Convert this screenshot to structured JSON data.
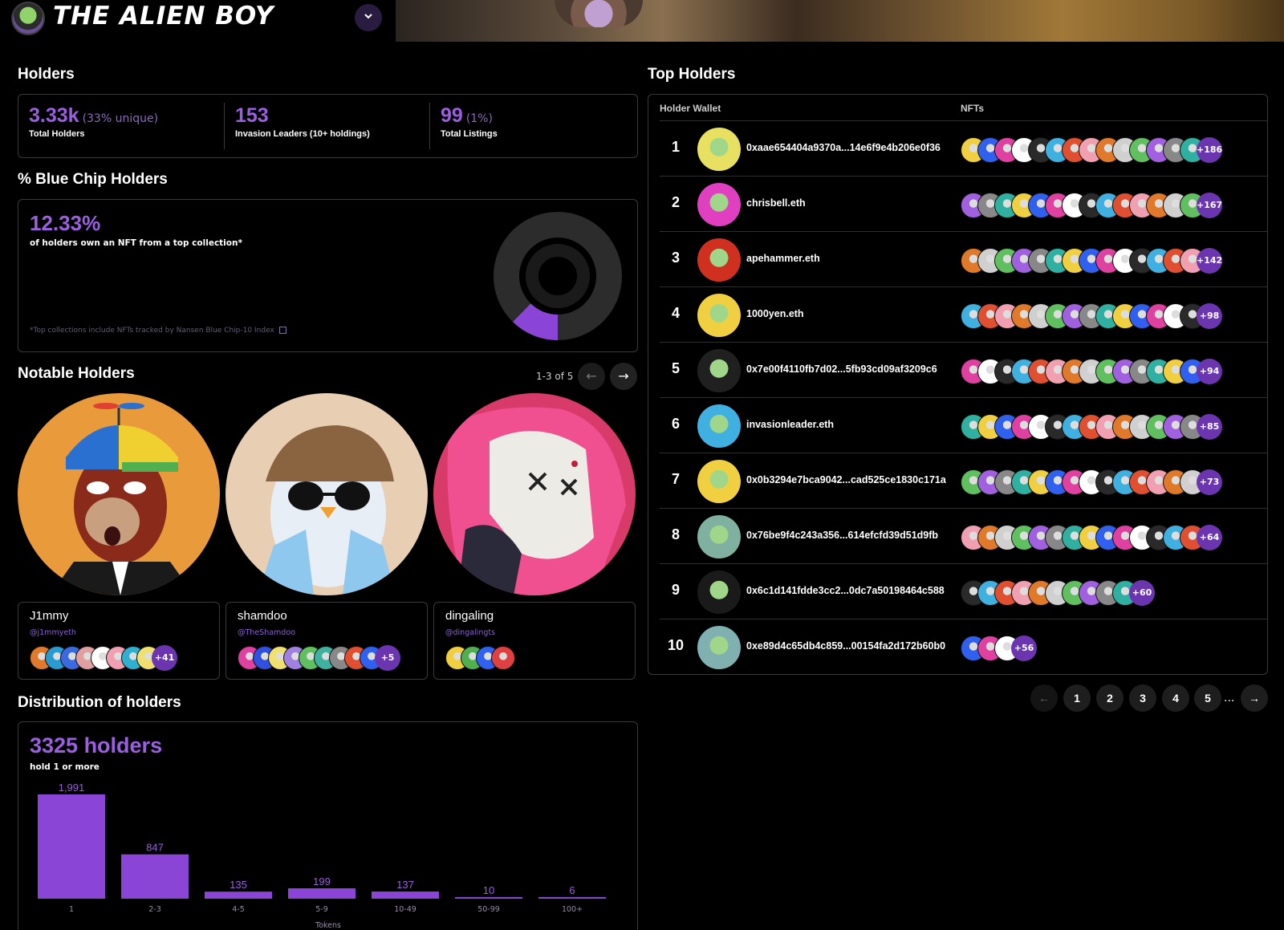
{
  "app": {
    "title": "THE ALIEN BOY",
    "dropdown_icon": "chevron-down-icon"
  },
  "holders": {
    "title": "Holders",
    "total": {
      "value": "3.33k",
      "note": "(33% unique)",
      "label": "Total Holders"
    },
    "leaders": {
      "value": "153",
      "label": "Invasion Leaders (10+ holdings)"
    },
    "listings": {
      "value": "99",
      "note": "(1%)",
      "label": "Total Listings"
    }
  },
  "blue_chip": {
    "title": "% Blue Chip Holders",
    "percent": "12.33%",
    "subtitle": "of holders own an NFT from a top collection*",
    "note": "*Top collections include NFTs tracked by Nansen Blue Chip-10 Index",
    "share": 0.1233,
    "colors": {
      "accent": "#8b45d6",
      "track": "#2c2c2c"
    }
  },
  "notable": {
    "title": "Notable Holders",
    "range": "1-3 of 5",
    "holders": [
      {
        "name": "J1mmy",
        "handle": "@j1mmyeth",
        "more": "+41",
        "avatar_colors": [
          "#e07a2a",
          "#2a9ad0",
          "#3a6ae0",
          "#e0a0a0",
          "#ffffff",
          "#f0a0b0",
          "#30b0d0",
          "#f0e070"
        ]
      },
      {
        "name": "shamdoo",
        "handle": "@TheShamdoo",
        "more": "+5",
        "avatar_colors": [
          "#e040a0",
          "#3050e0",
          "#f0e070",
          "#a080e0",
          "#60c060",
          "#40b0a0",
          "#888888",
          "#e05030",
          "#3060f0"
        ]
      },
      {
        "name": "dingaling",
        "handle": "@dingalingts",
        "more": "",
        "avatar_colors": [
          "#f0d040",
          "#50b050",
          "#3060f0",
          "#e04040"
        ]
      }
    ]
  },
  "distribution": {
    "title": "Distribution of holders",
    "total": "3325 holders",
    "subtitle": "hold 1 or more"
  },
  "chart_data": {
    "type": "bar",
    "categories": [
      "1",
      "2-3",
      "4-5",
      "5-9",
      "10-49",
      "50-99",
      "100+"
    ],
    "values": [
      1991,
      847,
      135,
      199,
      137,
      10,
      6
    ],
    "xlabel": "Tokens",
    "ylabel": "",
    "color": "#8b45d6"
  },
  "top_holders": {
    "title": "Top Holders",
    "col_wallet": "Holder Wallet",
    "col_nfts": "NFTs",
    "rows": [
      {
        "rank": "1",
        "wallet": "0xaae654404a9370a...14e6f9e4b206e0f36",
        "more": "+186",
        "avatar_bg": "#e8e060",
        "count": 14
      },
      {
        "rank": "2",
        "wallet": "chrisbell.eth",
        "more": "+167",
        "avatar_bg": "#e040c0",
        "count": 14
      },
      {
        "rank": "3",
        "wallet": "apehammer.eth",
        "more": "+142",
        "avatar_bg": "#d03020",
        "count": 14
      },
      {
        "rank": "4",
        "wallet": "1000yen.eth",
        "more": "+98",
        "avatar_bg": "#f0d040",
        "count": 14
      },
      {
        "rank": "5",
        "wallet": "0x7e00f4110fb7d02...5fb93cd09af3209c6",
        "more": "+94",
        "avatar_bg": "#202020",
        "count": 14
      },
      {
        "rank": "6",
        "wallet": "invasionleader.eth",
        "more": "+85",
        "avatar_bg": "#40b0e0",
        "count": 14
      },
      {
        "rank": "7",
        "wallet": "0x0b3294e7bca9042...cad525ce1830c171a",
        "more": "+73",
        "avatar_bg": "#f0d040",
        "count": 14
      },
      {
        "rank": "8",
        "wallet": "0x76be9f4c243a356...614efcfd39d51d9fb",
        "more": "+64",
        "avatar_bg": "#80b0a0",
        "count": 14
      },
      {
        "rank": "9",
        "wallet": "0x6c1d141fdde3cc2...0dc7a50198464c588",
        "more": "+60",
        "avatar_bg": "#1a1a1a",
        "count": 10
      },
      {
        "rank": "10",
        "wallet": "0xe89d4c65db4c859...00154fa2d172b60b0",
        "more": "+56",
        "avatar_bg": "#80b0b0",
        "count": 3
      }
    ],
    "pagination": {
      "pages": [
        "1",
        "2",
        "3",
        "4",
        "5"
      ],
      "ellipsis": "..."
    }
  },
  "palette": [
    "#f0d040",
    "#40b0e0",
    "#60c060",
    "#3060f0",
    "#e05030",
    "#a060e0",
    "#e040a0",
    "#f0a0b0",
    "#888888",
    "#ffffff",
    "#e07a2a",
    "#30b0a0",
    "#2a2a2a",
    "#d0d0d0"
  ]
}
